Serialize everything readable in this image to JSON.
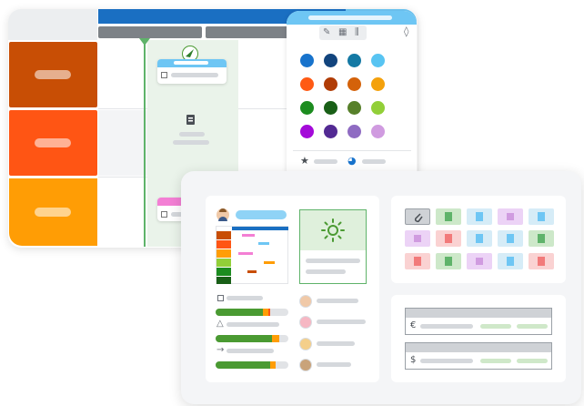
{
  "colors": {
    "header_blue": "#1a6fc2",
    "header_light": "#6ec6f4",
    "row_colors": [
      "#c84e05",
      "#ff5514",
      "#ff9d05"
    ],
    "timeline_green": "#5fb36a",
    "column_tint": "#eaf3ea",
    "palette_rows": [
      [
        "#1873cc",
        "#12447d",
        "#1479a4",
        "#58c4f2"
      ],
      [
        "#ff5a14",
        "#b03c06",
        "#d4620a",
        "#f4a10c"
      ],
      [
        "#1c8c1f",
        "#195f17",
        "#57802a",
        "#92cf38"
      ],
      [
        "#a40ad9",
        "#532a93",
        "#8f6bc2",
        "#d09be0"
      ]
    ],
    "panel_bg": "#f4f5f7",
    "sun_green": "#4a9a32"
  },
  "icons": {
    "timeline_marker": "triangle-marker-icon",
    "toolbar": [
      "paint-bucket-icon",
      "qr-code-icon",
      "column-icon"
    ],
    "drop": "drop-icon",
    "star": "star-icon",
    "pie": "pie-chart-icon",
    "attachment": "paperclip-icon",
    "file": "file-icon",
    "sun": "sun-icon",
    "euro": "€",
    "dollar": "$"
  },
  "progress": {
    "green_fractions": [
      0.65,
      0.8,
      0.75,
      0.75
    ]
  }
}
